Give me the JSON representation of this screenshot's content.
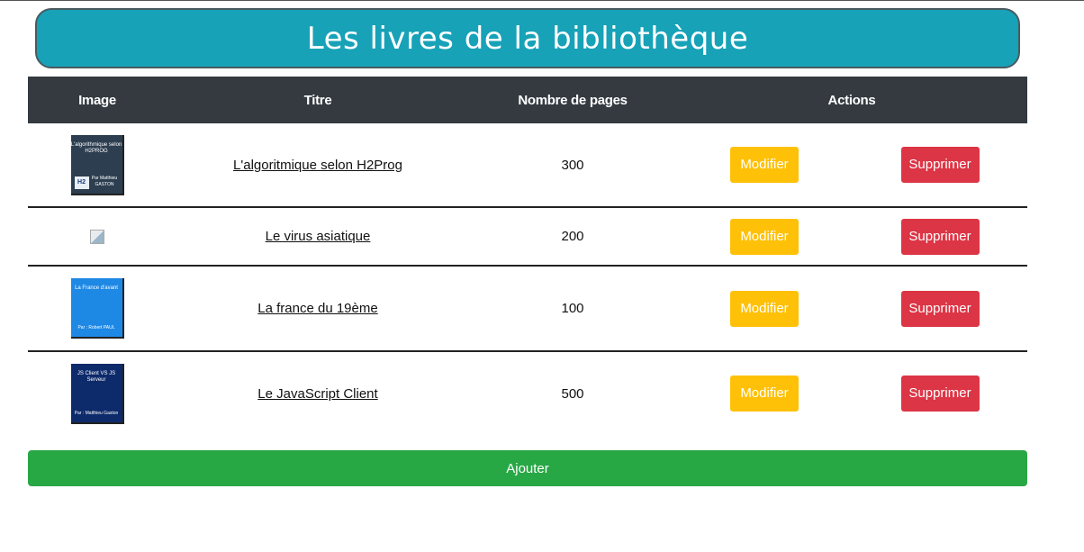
{
  "page": {
    "title": "Les livres de la bibliothèque"
  },
  "table": {
    "headers": {
      "image": "Image",
      "title": "Titre",
      "pages": "Nombre de pages",
      "actions": "Actions"
    },
    "rows": [
      {
        "title": "L'algoritmique selon H2Prog",
        "pages": "300",
        "cover": {
          "style": "dark",
          "text": "L'algorithmique selon H2PROG",
          "author": "Par Matthieu GASTON",
          "logo": "H2"
        }
      },
      {
        "title": "Le virus asiatique",
        "pages": "200",
        "cover": null
      },
      {
        "title": "La france du 19ème",
        "pages": "100",
        "cover": {
          "style": "blue",
          "text": "La France d'avant",
          "author": "Par : Robert PAUL"
        }
      },
      {
        "title": "Le JavaScript Client",
        "pages": "500",
        "cover": {
          "style": "navy",
          "text": "JS Client VS JS Serveur",
          "author": "Par : Matthieu Gaston"
        }
      }
    ],
    "modify_label": "Modifier",
    "delete_label": "Supprimer"
  },
  "add_label": "Ajouter",
  "colors": {
    "title_bg": "#17a2b8",
    "header_bg": "#343a40",
    "modify": "#ffc107",
    "delete": "#dc3545",
    "add": "#28a745"
  },
  "icons": {
    "broken_image": "broken-image-icon"
  }
}
